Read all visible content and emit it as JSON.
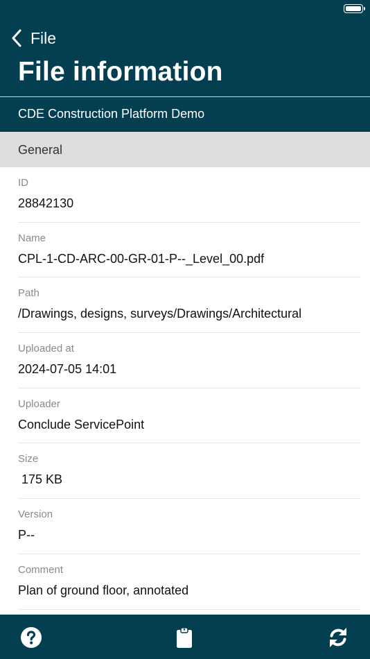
{
  "nav": {
    "back_label": "File",
    "title": "File information"
  },
  "project": "CDE Construction Platform Demo",
  "section": "General",
  "fields": [
    {
      "label": "ID",
      "value": "28842130"
    },
    {
      "label": "Name",
      "value": "CPL-1-CD-ARC-00-GR-01-P--_Level_00.pdf"
    },
    {
      "label": "Path",
      "value": "/Drawings, designs, surveys/Drawings/Architectural"
    },
    {
      "label": "Uploaded at",
      "value": "2024-07-05 14:01"
    },
    {
      "label": "Uploader",
      "value": "Conclude ServicePoint"
    },
    {
      "label": "Size",
      "value": " 175 KB"
    },
    {
      "label": "Version",
      "value": "P--"
    },
    {
      "label": "Comment",
      "value": "Plan of ground floor, annotated"
    }
  ],
  "tabbar": {
    "icons": [
      "help-icon",
      "clipboard-icon",
      "refresh-icon"
    ]
  },
  "colors": {
    "header": "#033f51",
    "section": "#dedede"
  }
}
